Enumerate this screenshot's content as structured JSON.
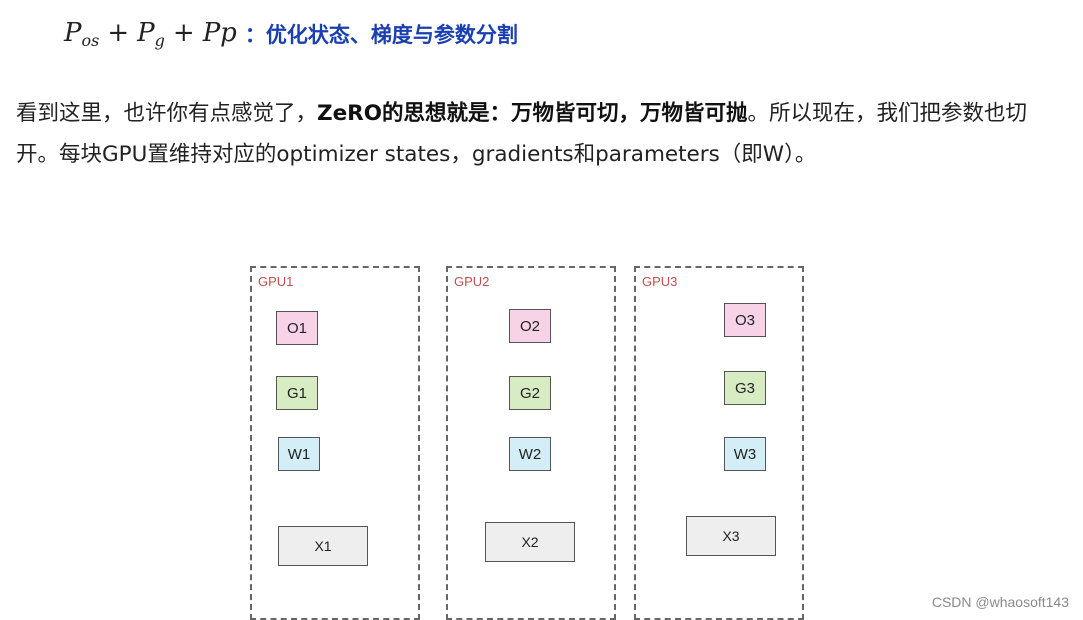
{
  "heading": {
    "formula_parts": [
      "P",
      "os",
      "+",
      "P",
      "g",
      "+",
      "Pp"
    ],
    "colon": "：",
    "text": "优化状态、梯度与参数分割"
  },
  "paragraph": {
    "lead": "看到这里，也许你有点感觉了，",
    "bold": "ZeRO的思想就是：万物皆可切，万物皆可抛",
    "tail": "。所以现在，我们把参数也切开。每块GPU置维持对应的optimizer states，gradients和parameters（即W）。"
  },
  "figure": {
    "gpus": [
      {
        "label": "GPU1",
        "o": "O1",
        "g": "G1",
        "w": "W1",
        "x": "X1"
      },
      {
        "label": "GPU2",
        "o": "O2",
        "g": "G2",
        "w": "W2",
        "x": "X2"
      },
      {
        "label": "GPU3",
        "o": "O3",
        "g": "G3",
        "w": "W3",
        "x": "X3"
      }
    ],
    "colors": {
      "o_fill": "#f8d3e8",
      "g_fill": "#d8ecc4",
      "w_fill": "#d3eef6",
      "x_fill": "#eeeeee",
      "gpu_label": "#c0504d",
      "border": "#666666"
    }
  },
  "watermark": "CSDN @whaosoft143"
}
